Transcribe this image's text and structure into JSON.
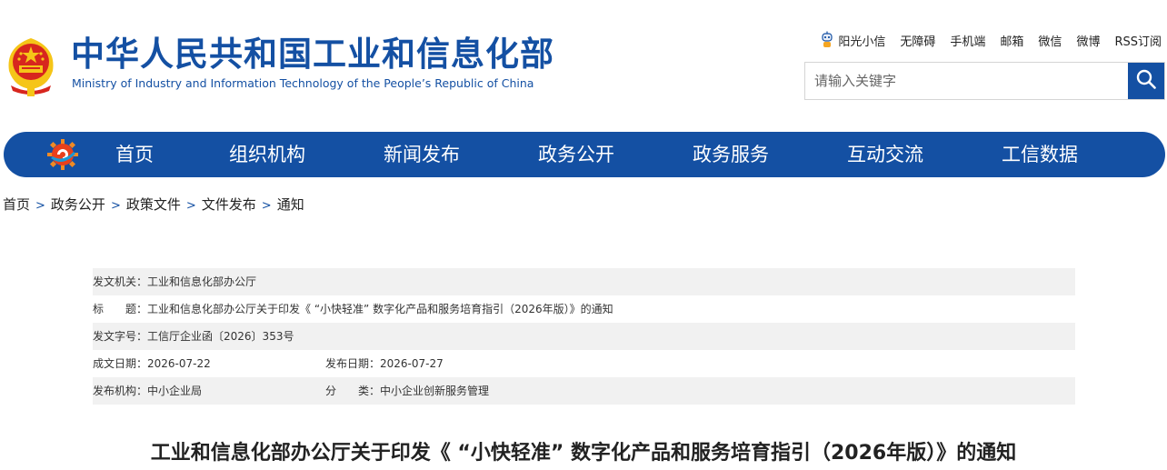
{
  "header": {
    "title": "中华人民共和国工业和信息化部",
    "subtitle": "Ministry of Industry and Information Technology of the People’s Republic of China",
    "emblem_icon": "national-emblem-icon"
  },
  "util_links": [
    "阳光小信",
    "无障碍",
    "手机端",
    "邮箱",
    "微信",
    "微博",
    "RSS订阅"
  ],
  "search": {
    "placeholder": "请输入关键字",
    "button_icon": "search-icon"
  },
  "nav": {
    "items": [
      "首页",
      "组织机构",
      "新闻发布",
      "政务公开",
      "政务服务",
      "互动交流",
      "工信数据"
    ]
  },
  "breadcrumb": [
    "首页",
    "政务公开",
    "政策文件",
    "文件发布",
    "通知"
  ],
  "meta": {
    "issuer_label": "发文机关：",
    "issuer": "工业和信息化部办公厅",
    "title_label": "标　　题：",
    "title": "工业和信息化部办公厅关于印发《 “小快轻准” 数字化产品和服务培育指引（2026年版）》的通知",
    "doc_no_label": "发文字号：",
    "doc_no": "工信厅企业函〔2026〕353号",
    "date_created_label": "成文日期：",
    "date_created": "2026-07-22",
    "date_published_label": "发布日期：",
    "date_published": "2026-07-27",
    "agency_label": "发布机构：",
    "agency": "中小企业局",
    "category_label": "分　　类：",
    "category": "中小企业创新服务管理"
  },
  "document": {
    "title": "工业和信息化部办公厅关于印发《 “小快轻准” 数字化产品和服务培育指引（2026年版）》的通知"
  },
  "colors": {
    "brand_blue": "#1450a3",
    "row_shade": "#f1f1f1",
    "emblem_red": "#d7261e",
    "emblem_gold": "#f5c518"
  }
}
